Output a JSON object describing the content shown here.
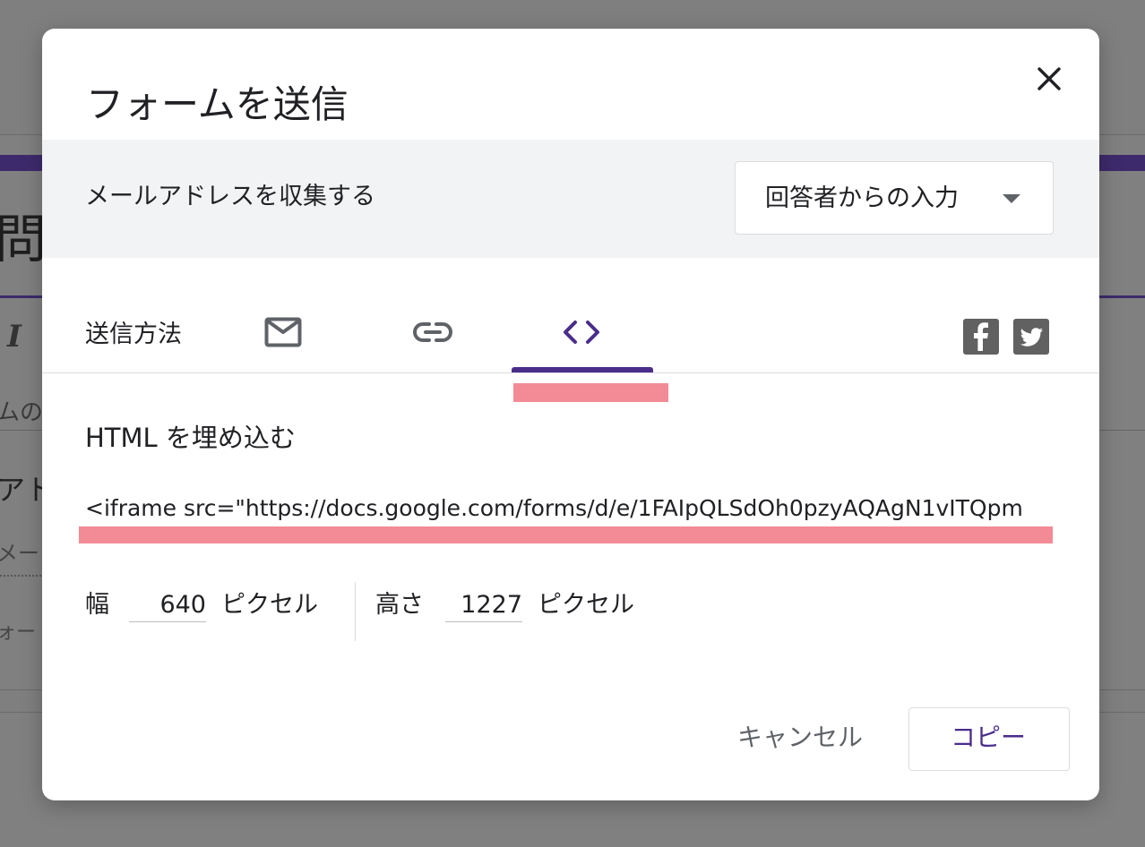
{
  "background": {
    "form_title_fragment": "問合",
    "text_fragment_1": "ムの",
    "text_fragment_2": "アト",
    "text_fragment_3": "メー",
    "text_fragment_4": "ォー"
  },
  "dialog": {
    "title": "フォームを送信",
    "close_icon": "close-icon",
    "collect_email": {
      "label": "メールアドレスを収集する",
      "selected_option": "回答者からの入力"
    },
    "send_method": {
      "label": "送信方法",
      "tabs": [
        {
          "icon": "email-icon",
          "selected": false
        },
        {
          "icon": "link-icon",
          "selected": false
        },
        {
          "icon": "embed-code-icon",
          "selected": true
        }
      ],
      "share_icons": [
        "facebook-icon",
        "twitter-icon"
      ]
    },
    "embed": {
      "heading": "HTML を埋め込む",
      "code": "<iframe src=\"https://docs.google.com/forms/d/e/1FAIpQLSdOh0pzyAQAgN1vITQpm",
      "width_label": "幅",
      "width_value": "640",
      "width_unit": "ピクセル",
      "height_label": "高さ",
      "height_value": "1227",
      "height_unit": "ピクセル"
    },
    "buttons": {
      "cancel": "キャンセル",
      "copy": "コピー"
    }
  },
  "colors": {
    "accent": "#4a2d8a",
    "highlight_mark": "#f28b96",
    "overlay": "#7f7f7f"
  }
}
